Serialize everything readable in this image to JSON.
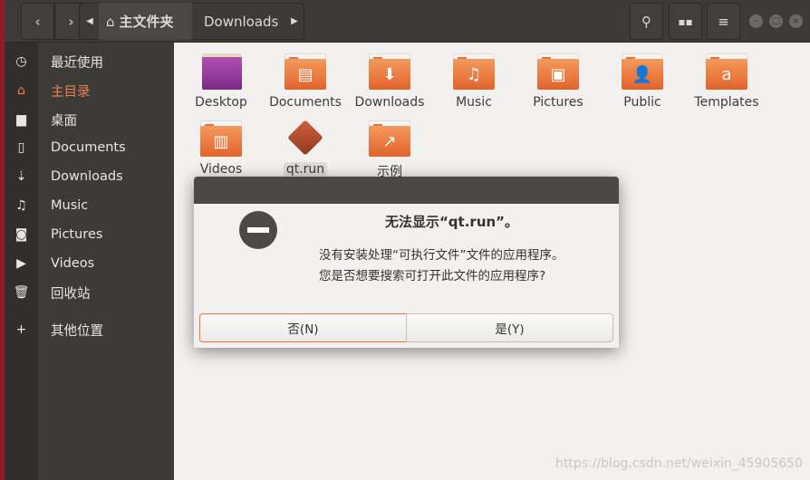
{
  "header": {
    "breadcrumb": [
      {
        "label": "主文件夹",
        "icon": "home-icon"
      },
      {
        "label": "Downloads"
      }
    ],
    "buttons": [
      "back",
      "forward",
      "search",
      "view-toggle",
      "menu"
    ],
    "window_controls": [
      "minimize",
      "maximize",
      "close"
    ]
  },
  "sidebar": {
    "items": [
      {
        "label": "最近使用",
        "icon": "clock-icon",
        "glyph": "◷"
      },
      {
        "label": "主目录",
        "icon": "home-icon",
        "glyph": "⌂",
        "active": true
      },
      {
        "label": "桌面",
        "icon": "folder-icon",
        "glyph": "▆"
      },
      {
        "label": "Documents",
        "icon": "document-icon",
        "glyph": "▯"
      },
      {
        "label": "Downloads",
        "icon": "download-icon",
        "glyph": "⇣"
      },
      {
        "label": "Music",
        "icon": "music-icon",
        "glyph": "♫"
      },
      {
        "label": "Pictures",
        "icon": "camera-icon",
        "glyph": "◙"
      },
      {
        "label": "Videos",
        "icon": "video-icon",
        "glyph": "▶"
      },
      {
        "label": "回收站",
        "icon": "trash-icon",
        "glyph": "🗑"
      },
      {
        "label": "其他位置",
        "icon": "plus-icon",
        "glyph": "+"
      }
    ]
  },
  "files": [
    {
      "name": "Desktop",
      "icon": "desktop-folder-icon",
      "glyph": ""
    },
    {
      "name": "Documents",
      "icon": "documents-folder-icon",
      "glyph": "▤"
    },
    {
      "name": "Downloads",
      "icon": "downloads-folder-icon",
      "glyph": "⬇"
    },
    {
      "name": "Music",
      "icon": "music-folder-icon",
      "glyph": "♫"
    },
    {
      "name": "Pictures",
      "icon": "pictures-folder-icon",
      "glyph": "▣"
    },
    {
      "name": "Public",
      "icon": "public-folder-icon",
      "glyph": "👤"
    },
    {
      "name": "Templates",
      "icon": "templates-folder-icon",
      "glyph": "a"
    },
    {
      "name": "Videos",
      "icon": "videos-folder-icon",
      "glyph": "▥"
    },
    {
      "name": "qt.run",
      "icon": "executable-file-icon",
      "glyph": ""
    },
    {
      "name": "示例",
      "icon": "link-folder-icon",
      "glyph": "↗"
    }
  ],
  "dialog": {
    "title": "无法显示“qt.run”。",
    "line1": "没有安装处理“可执行文件”文件的应用程序。",
    "line2": "您是否想要搜索可打开此文件的应用程序?",
    "no_label": "否(N)",
    "yes_label": "是(Y)",
    "accent": "#e95420"
  },
  "watermark": "https://blog.csdn.net/weixin_45905650"
}
